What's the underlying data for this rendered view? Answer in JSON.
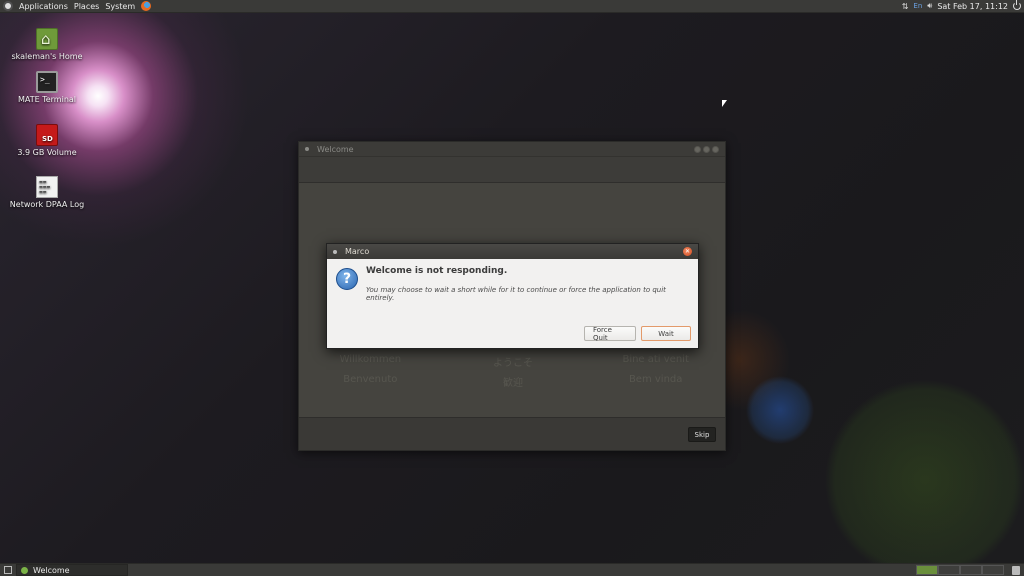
{
  "top_panel": {
    "menus": [
      "Applications",
      "Places",
      "System"
    ],
    "clock": "Sat Feb 17, 11:12",
    "keyboard_layout": "En"
  },
  "desktop_icons": [
    {
      "label": "skaleman's Home",
      "icon": "home-folder-icon"
    },
    {
      "label": "MATE Terminal",
      "icon": "terminal-icon"
    },
    {
      "label": "3.9 GB Volume",
      "icon": "sd-card-icon"
    },
    {
      "label": "Network DPAA Log",
      "icon": "text-file-icon"
    }
  ],
  "welcome_window": {
    "title": "Welcome",
    "languages": [
      "Willkommen",
      "ようこそ",
      "Bine ati venit",
      "Benvenuto",
      "歓迎",
      "Bem vinda"
    ],
    "skip_label": "Skip"
  },
  "marco_dialog": {
    "title": "Marco",
    "heading": "Welcome is not responding.",
    "message": "You may choose to wait a short while for it to continue or force the application to quit entirely.",
    "force_quit_label": "Force Quit",
    "wait_label": "Wait"
  },
  "bottom_panel": {
    "task_label": "Welcome"
  },
  "colors": {
    "panel": "#3a3a38",
    "dialog_bg": "#f2f1f0",
    "question_icon": "#2a65b0",
    "close_button": "#d24a1e"
  }
}
